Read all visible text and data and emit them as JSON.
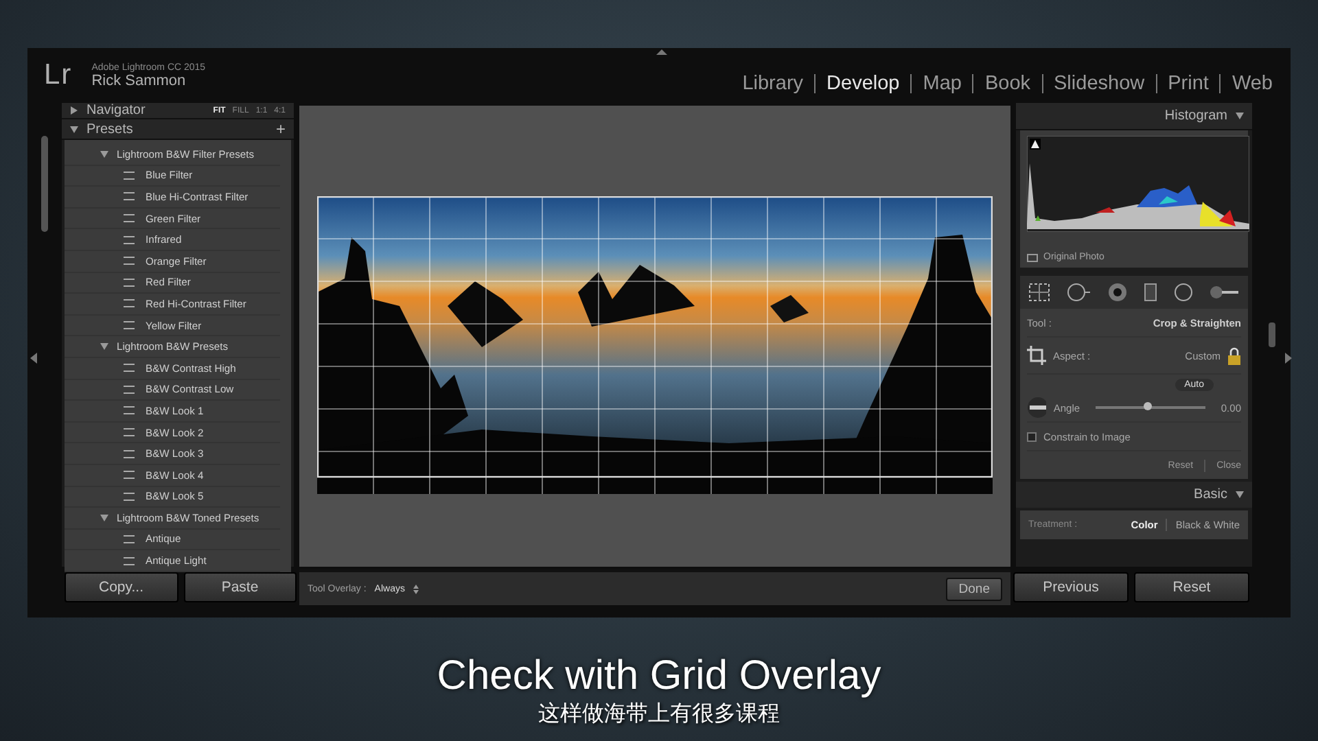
{
  "window": {
    "logo": "Lr",
    "app_name": "Adobe Lightroom CC 2015",
    "user": "Rick Sammon"
  },
  "modules": [
    {
      "label": "Library",
      "selected": false
    },
    {
      "label": "Develop",
      "selected": true
    },
    {
      "label": "Map",
      "selected": false
    },
    {
      "label": "Book",
      "selected": false
    },
    {
      "label": "Slideshow",
      "selected": false
    },
    {
      "label": "Print",
      "selected": false
    },
    {
      "label": "Web",
      "selected": false
    }
  ],
  "left_panel": {
    "navigator": {
      "title": "Navigator",
      "expanded": false,
      "zoom_options": [
        {
          "label": "FIT",
          "selected": true
        },
        {
          "label": "FILL",
          "selected": false
        },
        {
          "label": "1:1",
          "selected": false
        },
        {
          "label": "4:1",
          "selected": false
        }
      ]
    },
    "presets": {
      "title": "Presets",
      "expanded": true,
      "add": "+",
      "groups": [
        {
          "label": "Lightroom B&W Filter Presets",
          "expanded": true,
          "children": [
            {
              "label": "Blue Filter"
            },
            {
              "label": "Blue Hi-Contrast Filter"
            },
            {
              "label": "Green Filter"
            },
            {
              "label": "Infrared"
            },
            {
              "label": "Orange Filter"
            },
            {
              "label": "Red Filter"
            },
            {
              "label": "Red Hi-Contrast Filter"
            },
            {
              "label": "Yellow Filter"
            }
          ]
        },
        {
          "label": "Lightroom B&W Presets",
          "expanded": true,
          "children": [
            {
              "label": "B&W Contrast High"
            },
            {
              "label": "B&W Contrast Low"
            },
            {
              "label": "B&W Look 1"
            },
            {
              "label": "B&W Look 2"
            },
            {
              "label": "B&W Look 3"
            },
            {
              "label": "B&W Look 4"
            },
            {
              "label": "B&W Look 5"
            }
          ]
        },
        {
          "label": "Lightroom B&W Toned Presets",
          "expanded": true,
          "children": [
            {
              "label": "Antique"
            },
            {
              "label": "Antique Light"
            }
          ]
        }
      ]
    },
    "buttons": [
      "Copy...",
      "Paste"
    ]
  },
  "toolbar": {
    "tool_overlay_label": "Tool Overlay :",
    "tool_overlay_value": "Always",
    "done": "Done"
  },
  "right_panel": {
    "histogram": {
      "title": "Histogram",
      "expanded": true,
      "original_photo": {
        "label": "Original Photo",
        "checked": false
      }
    },
    "crop": {
      "tool_label": "Tool :",
      "tool_value": "Crop & Straighten",
      "aspect_label": "Aspect :",
      "aspect_value": "Custom",
      "locked": true,
      "auto": "Auto",
      "angle_label": "Angle",
      "angle": {
        "level": 0.48
      },
      "angle_value": "0.00",
      "constrain": {
        "label": "Constrain to Image",
        "checked": false
      },
      "reset": "Reset",
      "close": "Close"
    },
    "basic": {
      "title": "Basic",
      "expanded": true,
      "treatment_label": "Treatment :",
      "options": [
        {
          "label": "Color",
          "selected": true
        },
        {
          "label": "Black & White",
          "selected": false
        }
      ]
    },
    "buttons": [
      "Previous",
      "Reset"
    ]
  },
  "captions": {
    "title": "Check with Grid Overlay",
    "subtitle": "这样做海带上有很多课程"
  }
}
